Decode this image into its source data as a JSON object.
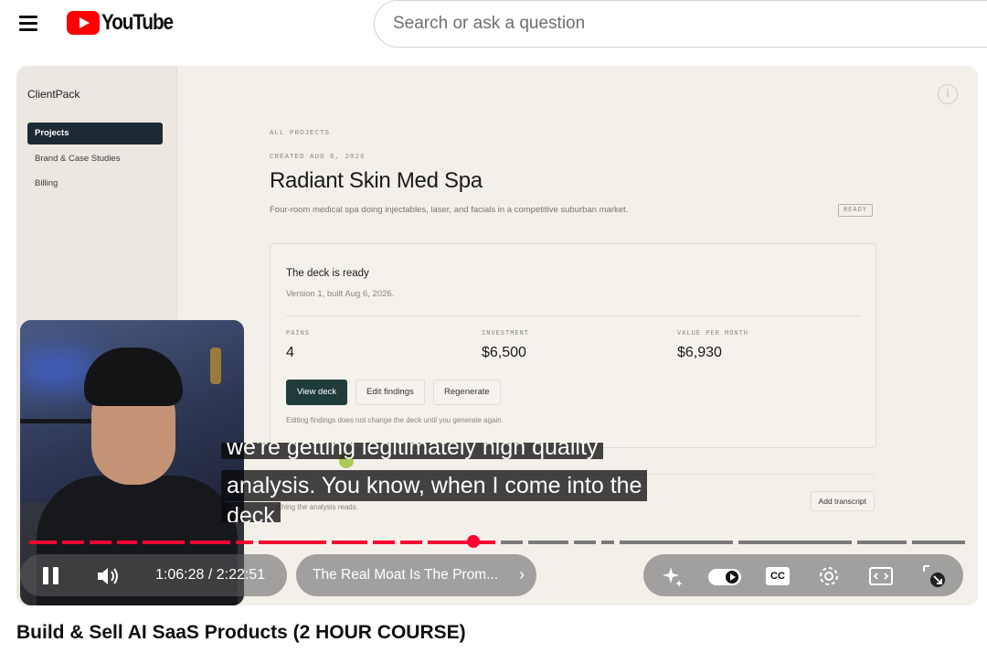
{
  "youtube": {
    "logo_text": "YouTube",
    "search_placeholder": "Search or ask a question"
  },
  "app": {
    "brand": "ClientPack",
    "sidebar": [
      {
        "label": "Projects",
        "active": true
      },
      {
        "label": "Brand & Case Studies",
        "active": false
      },
      {
        "label": "Billing",
        "active": false
      }
    ],
    "breadcrumb": "ALL PROJECTS",
    "created": "CREATED AUG 6, 2026",
    "title": "Radiant Skin Med Spa",
    "description": "Four-room medical spa doing injectables, laser, and facials in a competitive suburban market.",
    "status_badge": "READY",
    "deck": {
      "title": "The deck is ready",
      "subtitle": "Version 1, built Aug 6, 2026.",
      "stats": [
        {
          "label": "PAINS",
          "value": "4"
        },
        {
          "label": "INVESTMENT",
          "value": "$6,500"
        },
        {
          "label": "VALUE PER MONTH",
          "value": "$6,930"
        }
      ],
      "buttons": {
        "view": "View deck",
        "edit": "Edit findings",
        "regenerate": "Regenerate"
      },
      "note": "Editing findings does not change the deck until you generate again."
    },
    "transcript": {
      "reads": "...ything the analysis reads.",
      "add_button": "Add transcript"
    }
  },
  "captions": {
    "line1": "we're getting legitimately high quality",
    "line2": "analysis. You know, when I come into the",
    "line3": "deck"
  },
  "player": {
    "current_time": "1:06:28",
    "duration": "2:22:51",
    "time_display": "1:06:28 / 2:22:51",
    "chapter": "The Real Moat Is The Prom...",
    "progress_fraction": 0.48,
    "cc_label": "CC",
    "accent": "#ff0033"
  },
  "video": {
    "title": "Build & Sell AI SaaS Products (2 HOUR COURSE)"
  },
  "icons": [
    "menu-icon",
    "youtube-logo-icon",
    "info-icon",
    "pause-icon",
    "volume-icon",
    "chevron-right-icon",
    "sparkle-icon",
    "autoplay-toggle",
    "cc-icon",
    "settings-gear-icon",
    "miniplayer-icon",
    "fullscreen-icon"
  ]
}
